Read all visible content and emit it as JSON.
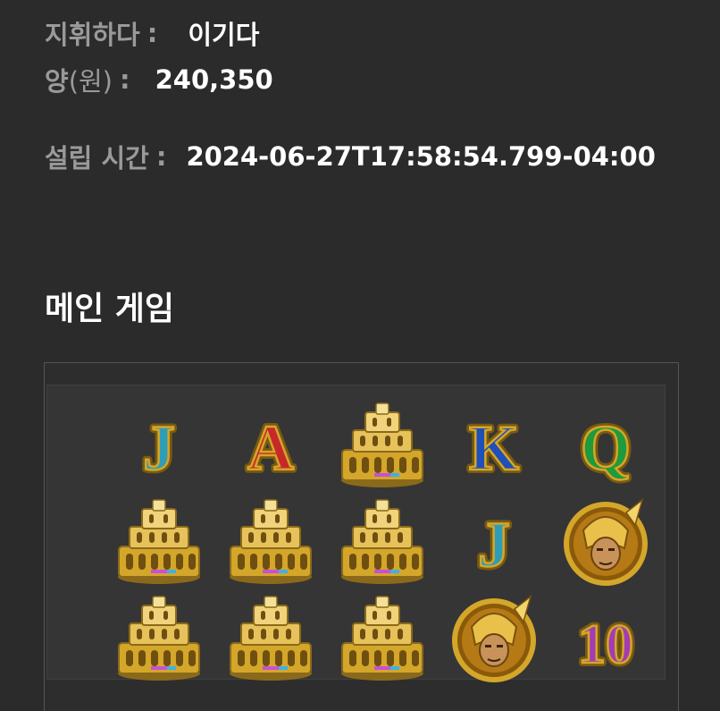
{
  "details": {
    "result_label": "지휘하다",
    "result_colon": ":",
    "result_value": "이기다",
    "amount_label": "양",
    "amount_unit": "(원)",
    "amount_colon": ":",
    "amount_value": "240,350",
    "time_label": "설립 시간",
    "time_colon": ":",
    "time_value": "2024-06-27T17:58:54.799-04:00"
  },
  "main_game": {
    "title": "메인 게임",
    "grid": [
      [
        "J",
        "A",
        "colosseum",
        "K",
        "Q"
      ],
      [
        "colosseum",
        "colosseum",
        "colosseum",
        "J",
        "gladiator"
      ],
      [
        "colosseum",
        "colosseum",
        "colosseum",
        "gladiator",
        "10"
      ]
    ],
    "letter_colors": {
      "J": "#2f9db8",
      "A": "#c8282a",
      "K": "#1f4fb8",
      "Q": "#1f9a3c",
      "10": "#a33bb5"
    },
    "gold": "#d4a62a"
  }
}
